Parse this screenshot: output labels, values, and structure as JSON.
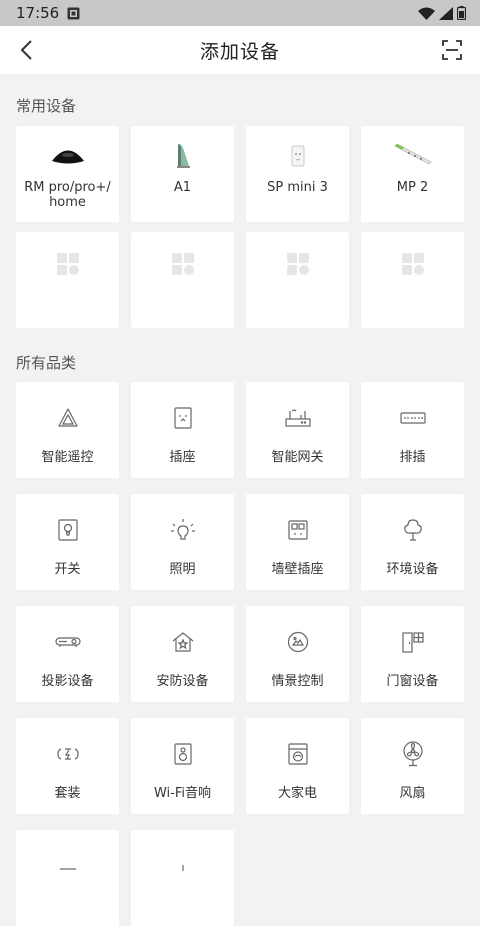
{
  "status": {
    "time": "17:56"
  },
  "header": {
    "title": "添加设备"
  },
  "common": {
    "title": "常用设备",
    "devices": [
      {
        "label": "RM pro/pro+/\nhome",
        "icon": "rm-pro-device-icon"
      },
      {
        "label": "A1",
        "icon": "a1-sensor-icon"
      },
      {
        "label": "SP mini 3",
        "icon": "sp-mini-plug-icon"
      },
      {
        "label": "MP 2",
        "icon": "power-strip-icon"
      }
    ],
    "placeholders": 4
  },
  "categories": {
    "title": "所有品类",
    "items": [
      {
        "label": "智能遥控",
        "icon": "remote-icon"
      },
      {
        "label": "插座",
        "icon": "socket-icon"
      },
      {
        "label": "智能网关",
        "icon": "gateway-icon"
      },
      {
        "label": "排插",
        "icon": "power-strip-icon"
      },
      {
        "label": "开关",
        "icon": "switch-icon"
      },
      {
        "label": "照明",
        "icon": "bulb-icon"
      },
      {
        "label": "墙壁插座",
        "icon": "wall-socket-icon"
      },
      {
        "label": "环境设备",
        "icon": "tree-icon"
      },
      {
        "label": "投影设备",
        "icon": "projector-icon"
      },
      {
        "label": "安防设备",
        "icon": "house-star-icon"
      },
      {
        "label": "情景控制",
        "icon": "scene-icon"
      },
      {
        "label": "门窗设备",
        "icon": "door-window-icon"
      },
      {
        "label": "套装",
        "icon": "kit-icon"
      },
      {
        "label": "Wi-Fi音响",
        "icon": "speaker-icon"
      },
      {
        "label": "大家电",
        "icon": "washer-icon"
      },
      {
        "label": "风扇",
        "icon": "fan-icon"
      }
    ]
  }
}
